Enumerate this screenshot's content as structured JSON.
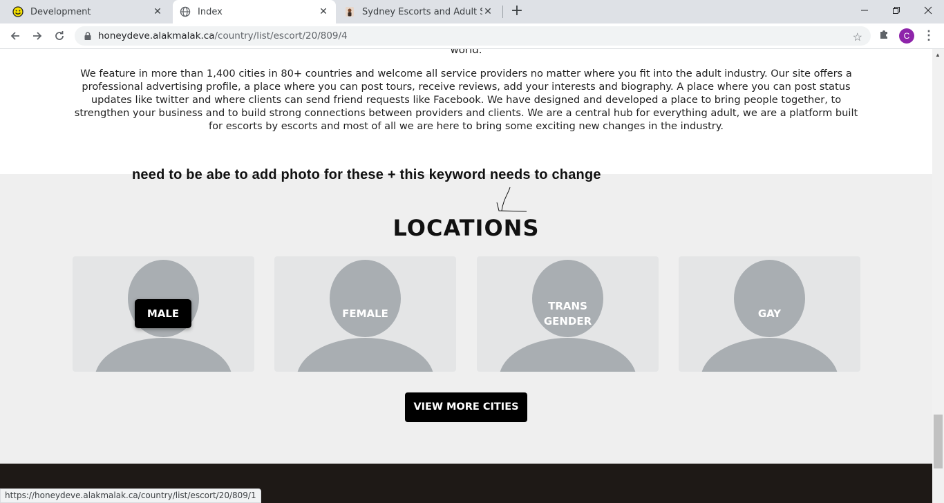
{
  "browser": {
    "tabs": [
      {
        "title": "Development",
        "favicon": "smiley-icon"
      },
      {
        "title": "Index",
        "favicon": "globe-icon"
      },
      {
        "title": "Sydney Escorts and Adult Service",
        "favicon": "person-icon"
      }
    ],
    "new_tab": "+",
    "url_host": "honeydeve.alakmalak.ca",
    "url_path": "/country/list/escort/20/809/4",
    "profile_initial": "C",
    "status_url": "https://honeydeve.alakmalak.ca/country/list/escort/20/809/1"
  },
  "page": {
    "cut_word": "world.",
    "about_text": "We feature in more than 1,400 cities in 80+ countries and welcome all service providers no matter where you fit into the adult industry. Our site offers a professional advertising profile, a place where you can post tours, receive reviews, add your interests and biography. A place where you can post status updates like twitter and where clients can send friend requests like Facebook. We have designed and developed a place to bring people together, to strengthen your business and to build strong connections between providers and clients. We are a central hub for everything adult, we are a platform built for escorts by escorts and most of all we are here to bring some exciting new changes in the industry.",
    "annotation_note": "need to be abe to add photo for these + this keyword needs to change",
    "locations_title": "LOCATIONS",
    "cards": [
      {
        "label": "MALE"
      },
      {
        "label": "FEMALE"
      },
      {
        "label": "TRANS GENDER",
        "line1": "TRANS",
        "line2": "GENDER"
      },
      {
        "label": "GAY"
      }
    ],
    "view_more_label": "VIEW MORE CITIES"
  },
  "colors": {
    "accent_button": "#000000",
    "placeholder_grey": "#a9aeb2",
    "card_bg": "#e4e5e6",
    "profile": "#8e24aa"
  }
}
